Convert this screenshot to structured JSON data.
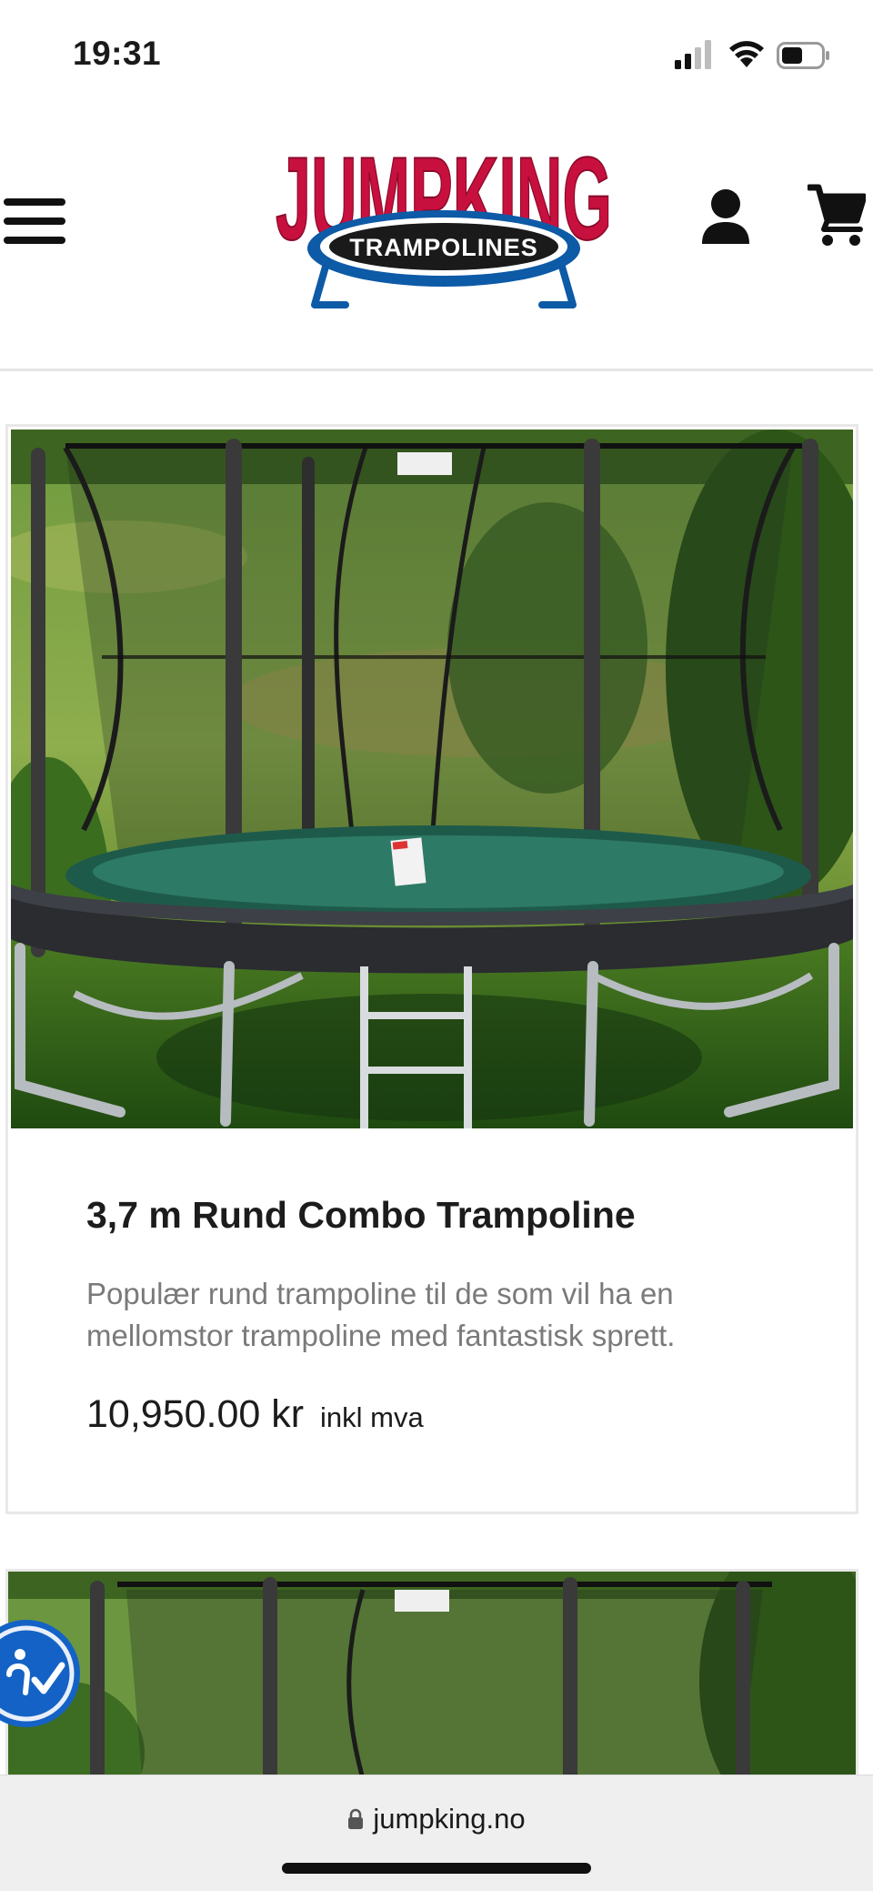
{
  "status_bar": {
    "time": "19:31"
  },
  "header": {
    "logo": {
      "wordmark": "JUMPKING",
      "tagline": "TRAMPOLINES",
      "brand_red": "#c8103e",
      "brand_blue": "#0d5aa7"
    },
    "icons": [
      "hamburger-menu-icon",
      "account-icon",
      "cart-icon"
    ]
  },
  "products": [
    {
      "title": "3,7 m Rund Combo Trampoline",
      "description": "Populær rund trampoline til de som vil ha en mellomstor trampoline med fantastisk sprett.",
      "price": "10,950.00 kr",
      "vat_note": "inkl mva"
    }
  ],
  "browser": {
    "url": "jumpking.no"
  },
  "colors": {
    "text_primary": "#1c1c1c",
    "text_secondary": "#7a7a7a",
    "accessibility_blue": "#1462c6",
    "card_border": "#e8e8e8"
  }
}
